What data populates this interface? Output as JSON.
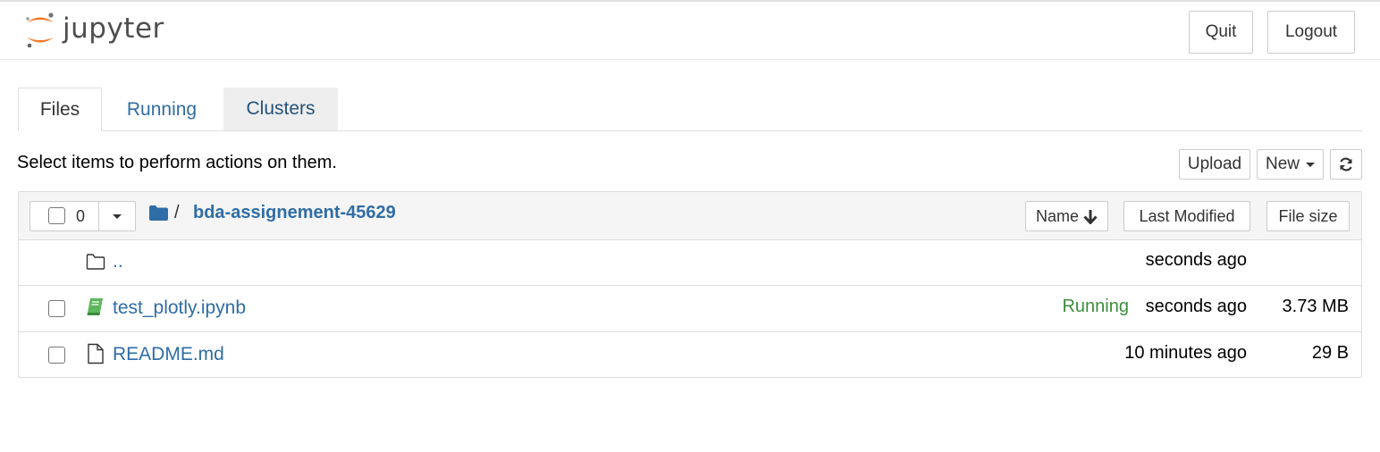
{
  "app": {
    "logo_text": "jupyter",
    "quit_label": "Quit",
    "logout_label": "Logout"
  },
  "tabs": [
    {
      "label": "Files",
      "active": true
    },
    {
      "label": "Running",
      "active": false
    },
    {
      "label": "Clusters",
      "active": false
    }
  ],
  "toolbar": {
    "hint": "Select items to perform actions on them.",
    "upload_label": "Upload",
    "new_label": "New",
    "refresh_icon": "refresh-icon"
  },
  "list_header": {
    "selected_count": "0",
    "breadcrumb_sep": "/",
    "breadcrumb_folder": "bda-assignement-45629",
    "sort_name_label": "Name",
    "sort_modified_label": "Last Modified",
    "sort_size_label": "File size"
  },
  "rows": [
    {
      "name": "..",
      "icon": "folder-icon",
      "status": "",
      "modified": "seconds ago",
      "size": ""
    },
    {
      "name": "test_plotly.ipynb",
      "icon": "notebook-icon",
      "status": "Running",
      "modified": "seconds ago",
      "size": "3.73 MB"
    },
    {
      "name": "README.md",
      "icon": "file-icon",
      "status": "",
      "modified": "10 minutes ago",
      "size": "29 B"
    }
  ],
  "colors": {
    "link": "#2f6da6",
    "running": "#3c8c3c",
    "logo_orange": "#f37726"
  }
}
